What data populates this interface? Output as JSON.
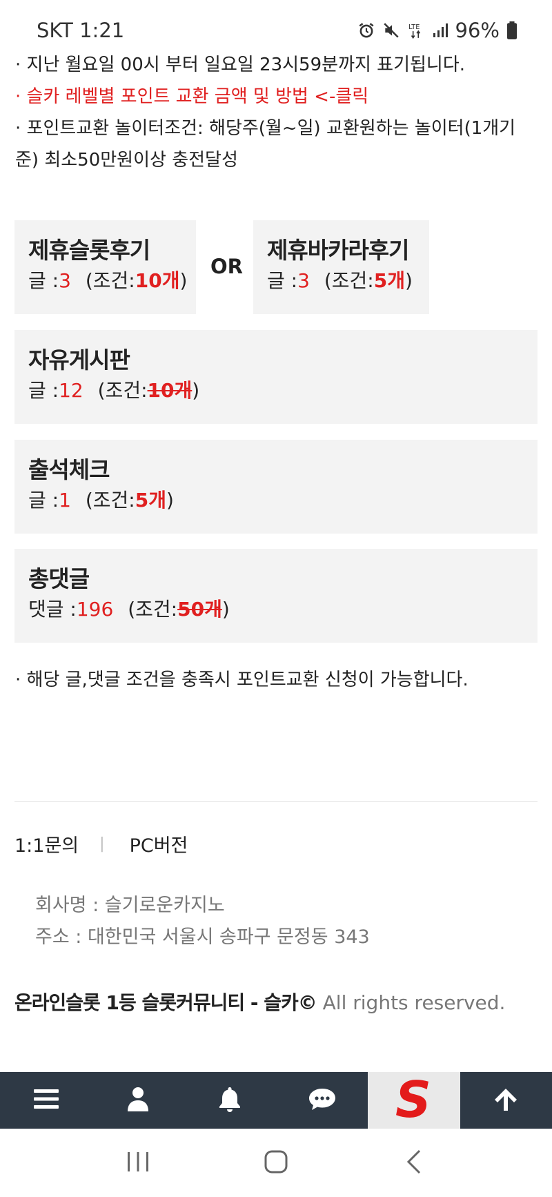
{
  "status_bar": {
    "carrier_time": "SKT 1:21",
    "battery": "96%"
  },
  "notices": {
    "line1": "· 지난 월요일 00시 부터 일요일 23시59분까지 표기됩니다.",
    "line2_link": "· 슬카 레벨별 포인트 교환 금액 및 방법 <-클릭",
    "line3a": "· 포인트교환 놀이터조건: 해당주(월~일) 교환원하는 놀이터(1개기",
    "line3b": "준) 최소50만원이상 충전달성"
  },
  "cards": {
    "slot_review": {
      "title": "제휴슬롯후기",
      "label": "글 :",
      "count": "3",
      "cond_open": "(조건:",
      "req": "10개",
      "cond_close": ")"
    },
    "or_label": "OR",
    "baccarat_review": {
      "title": "제휴바카라후기",
      "label": "글 :",
      "count": "3",
      "cond_open": "(조건:",
      "req": "5개",
      "cond_close": ")"
    },
    "free_board": {
      "title": "자유게시판",
      "label": "글 :",
      "count": "12",
      "cond_open": "(조건:",
      "req": "10개",
      "cond_close": ")"
    },
    "attendance": {
      "title": "출석체크",
      "label": "글 :",
      "count": "1",
      "cond_open": "(조건:",
      "req": "5개",
      "cond_close": ")"
    },
    "total_comments": {
      "title": "총댓글",
      "label": "댓글 :",
      "count": "196",
      "cond_open": "(조건:",
      "req": "50개",
      "cond_close": ")"
    }
  },
  "bottom_notice": "· 해당 글,댓글 조건을 충족시 포인트교환 신청이 가능합니다.",
  "footer": {
    "inquiry": "1:1문의",
    "separator": "|",
    "pc_version": "PC버전",
    "company_name": "회사명 : 슬기로운카지노",
    "address": "주소 : 대한민국 서울시 송파구 문정동 343",
    "copyright_bold": "온라인슬롯 1등 슬롯커뮤니티 - 슬카©",
    "copyright_rest": " All rights reserved."
  },
  "bottom_nav": {
    "icons": [
      "menu-icon",
      "user-icon",
      "bell-icon",
      "chat-icon",
      "logo-s",
      "arrow-up-icon"
    ],
    "logo_letter": "S",
    "logo_color": "#e31b1b",
    "bar_color": "#2e3945"
  }
}
